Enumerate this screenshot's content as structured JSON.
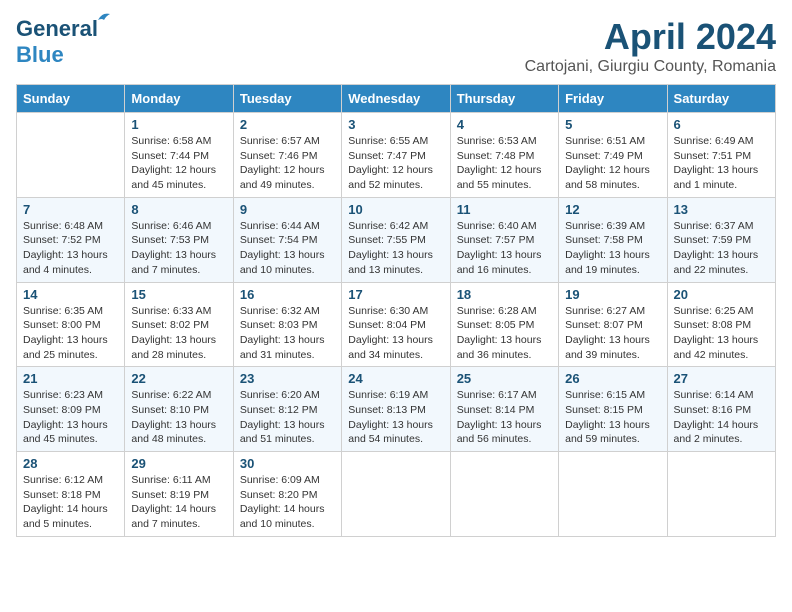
{
  "logo": {
    "general": "General",
    "blue": "Blue"
  },
  "title": "April 2024",
  "location": "Cartojani, Giurgiu County, Romania",
  "days_header": [
    "Sunday",
    "Monday",
    "Tuesday",
    "Wednesday",
    "Thursday",
    "Friday",
    "Saturday"
  ],
  "weeks": [
    [
      {
        "day": "",
        "content": ""
      },
      {
        "day": "1",
        "content": "Sunrise: 6:58 AM\nSunset: 7:44 PM\nDaylight: 12 hours\nand 45 minutes."
      },
      {
        "day": "2",
        "content": "Sunrise: 6:57 AM\nSunset: 7:46 PM\nDaylight: 12 hours\nand 49 minutes."
      },
      {
        "day": "3",
        "content": "Sunrise: 6:55 AM\nSunset: 7:47 PM\nDaylight: 12 hours\nand 52 minutes."
      },
      {
        "day": "4",
        "content": "Sunrise: 6:53 AM\nSunset: 7:48 PM\nDaylight: 12 hours\nand 55 minutes."
      },
      {
        "day": "5",
        "content": "Sunrise: 6:51 AM\nSunset: 7:49 PM\nDaylight: 12 hours\nand 58 minutes."
      },
      {
        "day": "6",
        "content": "Sunrise: 6:49 AM\nSunset: 7:51 PM\nDaylight: 13 hours\nand 1 minute."
      }
    ],
    [
      {
        "day": "7",
        "content": "Sunrise: 6:48 AM\nSunset: 7:52 PM\nDaylight: 13 hours\nand 4 minutes."
      },
      {
        "day": "8",
        "content": "Sunrise: 6:46 AM\nSunset: 7:53 PM\nDaylight: 13 hours\nand 7 minutes."
      },
      {
        "day": "9",
        "content": "Sunrise: 6:44 AM\nSunset: 7:54 PM\nDaylight: 13 hours\nand 10 minutes."
      },
      {
        "day": "10",
        "content": "Sunrise: 6:42 AM\nSunset: 7:55 PM\nDaylight: 13 hours\nand 13 minutes."
      },
      {
        "day": "11",
        "content": "Sunrise: 6:40 AM\nSunset: 7:57 PM\nDaylight: 13 hours\nand 16 minutes."
      },
      {
        "day": "12",
        "content": "Sunrise: 6:39 AM\nSunset: 7:58 PM\nDaylight: 13 hours\nand 19 minutes."
      },
      {
        "day": "13",
        "content": "Sunrise: 6:37 AM\nSunset: 7:59 PM\nDaylight: 13 hours\nand 22 minutes."
      }
    ],
    [
      {
        "day": "14",
        "content": "Sunrise: 6:35 AM\nSunset: 8:00 PM\nDaylight: 13 hours\nand 25 minutes."
      },
      {
        "day": "15",
        "content": "Sunrise: 6:33 AM\nSunset: 8:02 PM\nDaylight: 13 hours\nand 28 minutes."
      },
      {
        "day": "16",
        "content": "Sunrise: 6:32 AM\nSunset: 8:03 PM\nDaylight: 13 hours\nand 31 minutes."
      },
      {
        "day": "17",
        "content": "Sunrise: 6:30 AM\nSunset: 8:04 PM\nDaylight: 13 hours\nand 34 minutes."
      },
      {
        "day": "18",
        "content": "Sunrise: 6:28 AM\nSunset: 8:05 PM\nDaylight: 13 hours\nand 36 minutes."
      },
      {
        "day": "19",
        "content": "Sunrise: 6:27 AM\nSunset: 8:07 PM\nDaylight: 13 hours\nand 39 minutes."
      },
      {
        "day": "20",
        "content": "Sunrise: 6:25 AM\nSunset: 8:08 PM\nDaylight: 13 hours\nand 42 minutes."
      }
    ],
    [
      {
        "day": "21",
        "content": "Sunrise: 6:23 AM\nSunset: 8:09 PM\nDaylight: 13 hours\nand 45 minutes."
      },
      {
        "day": "22",
        "content": "Sunrise: 6:22 AM\nSunset: 8:10 PM\nDaylight: 13 hours\nand 48 minutes."
      },
      {
        "day": "23",
        "content": "Sunrise: 6:20 AM\nSunset: 8:12 PM\nDaylight: 13 hours\nand 51 minutes."
      },
      {
        "day": "24",
        "content": "Sunrise: 6:19 AM\nSunset: 8:13 PM\nDaylight: 13 hours\nand 54 minutes."
      },
      {
        "day": "25",
        "content": "Sunrise: 6:17 AM\nSunset: 8:14 PM\nDaylight: 13 hours\nand 56 minutes."
      },
      {
        "day": "26",
        "content": "Sunrise: 6:15 AM\nSunset: 8:15 PM\nDaylight: 13 hours\nand 59 minutes."
      },
      {
        "day": "27",
        "content": "Sunrise: 6:14 AM\nSunset: 8:16 PM\nDaylight: 14 hours\nand 2 minutes."
      }
    ],
    [
      {
        "day": "28",
        "content": "Sunrise: 6:12 AM\nSunset: 8:18 PM\nDaylight: 14 hours\nand 5 minutes."
      },
      {
        "day": "29",
        "content": "Sunrise: 6:11 AM\nSunset: 8:19 PM\nDaylight: 14 hours\nand 7 minutes."
      },
      {
        "day": "30",
        "content": "Sunrise: 6:09 AM\nSunset: 8:20 PM\nDaylight: 14 hours\nand 10 minutes."
      },
      {
        "day": "",
        "content": ""
      },
      {
        "day": "",
        "content": ""
      },
      {
        "day": "",
        "content": ""
      },
      {
        "day": "",
        "content": ""
      }
    ]
  ]
}
